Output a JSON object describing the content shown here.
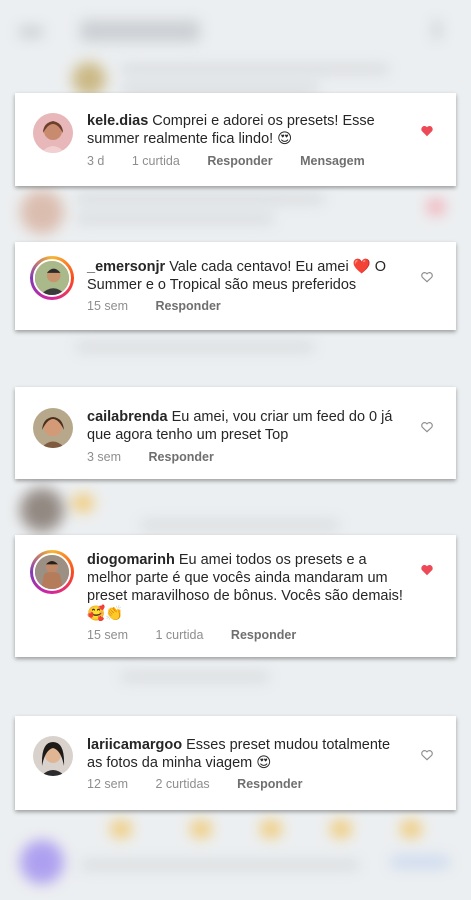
{
  "comments": [
    {
      "username": "kele.dias",
      "text": "Comprei e adorei os presets! Esse summer realmente fica lindo! 😍",
      "time": "3 d",
      "likes": "1 curtida",
      "reply": "Responder",
      "message": "Mensagem",
      "liked": true
    },
    {
      "username": "_emersonjr",
      "text": "Vale cada centavo! Eu amei ❤️ O Summer e o Tropical são meus preferidos",
      "time": "15 sem",
      "reply": "Responder",
      "liked": false
    },
    {
      "username": "cailabrenda",
      "text": "Eu amei, vou criar um feed do 0 já que agora tenho um preset Top",
      "time": "3 sem",
      "reply": "Responder",
      "liked": false
    },
    {
      "username": "diogomarinh",
      "text": "Eu amei todos os presets e a melhor parte é que vocês ainda mandaram um preset maravilhoso de bônus. Vocês são demais! 🥰👏",
      "time": "15 sem",
      "likes": "1 curtida",
      "reply": "Responder",
      "liked": true
    },
    {
      "username": "lariicamargoo",
      "text": "Esses preset mudou totalmente as fotos da minha viagem 😍",
      "time": "12 sem",
      "likes": "2 curtidas",
      "reply": "Responder",
      "liked": false
    }
  ],
  "colors": {
    "liked_heart": "#ed4956",
    "outline_heart": "#8e8e8e"
  }
}
